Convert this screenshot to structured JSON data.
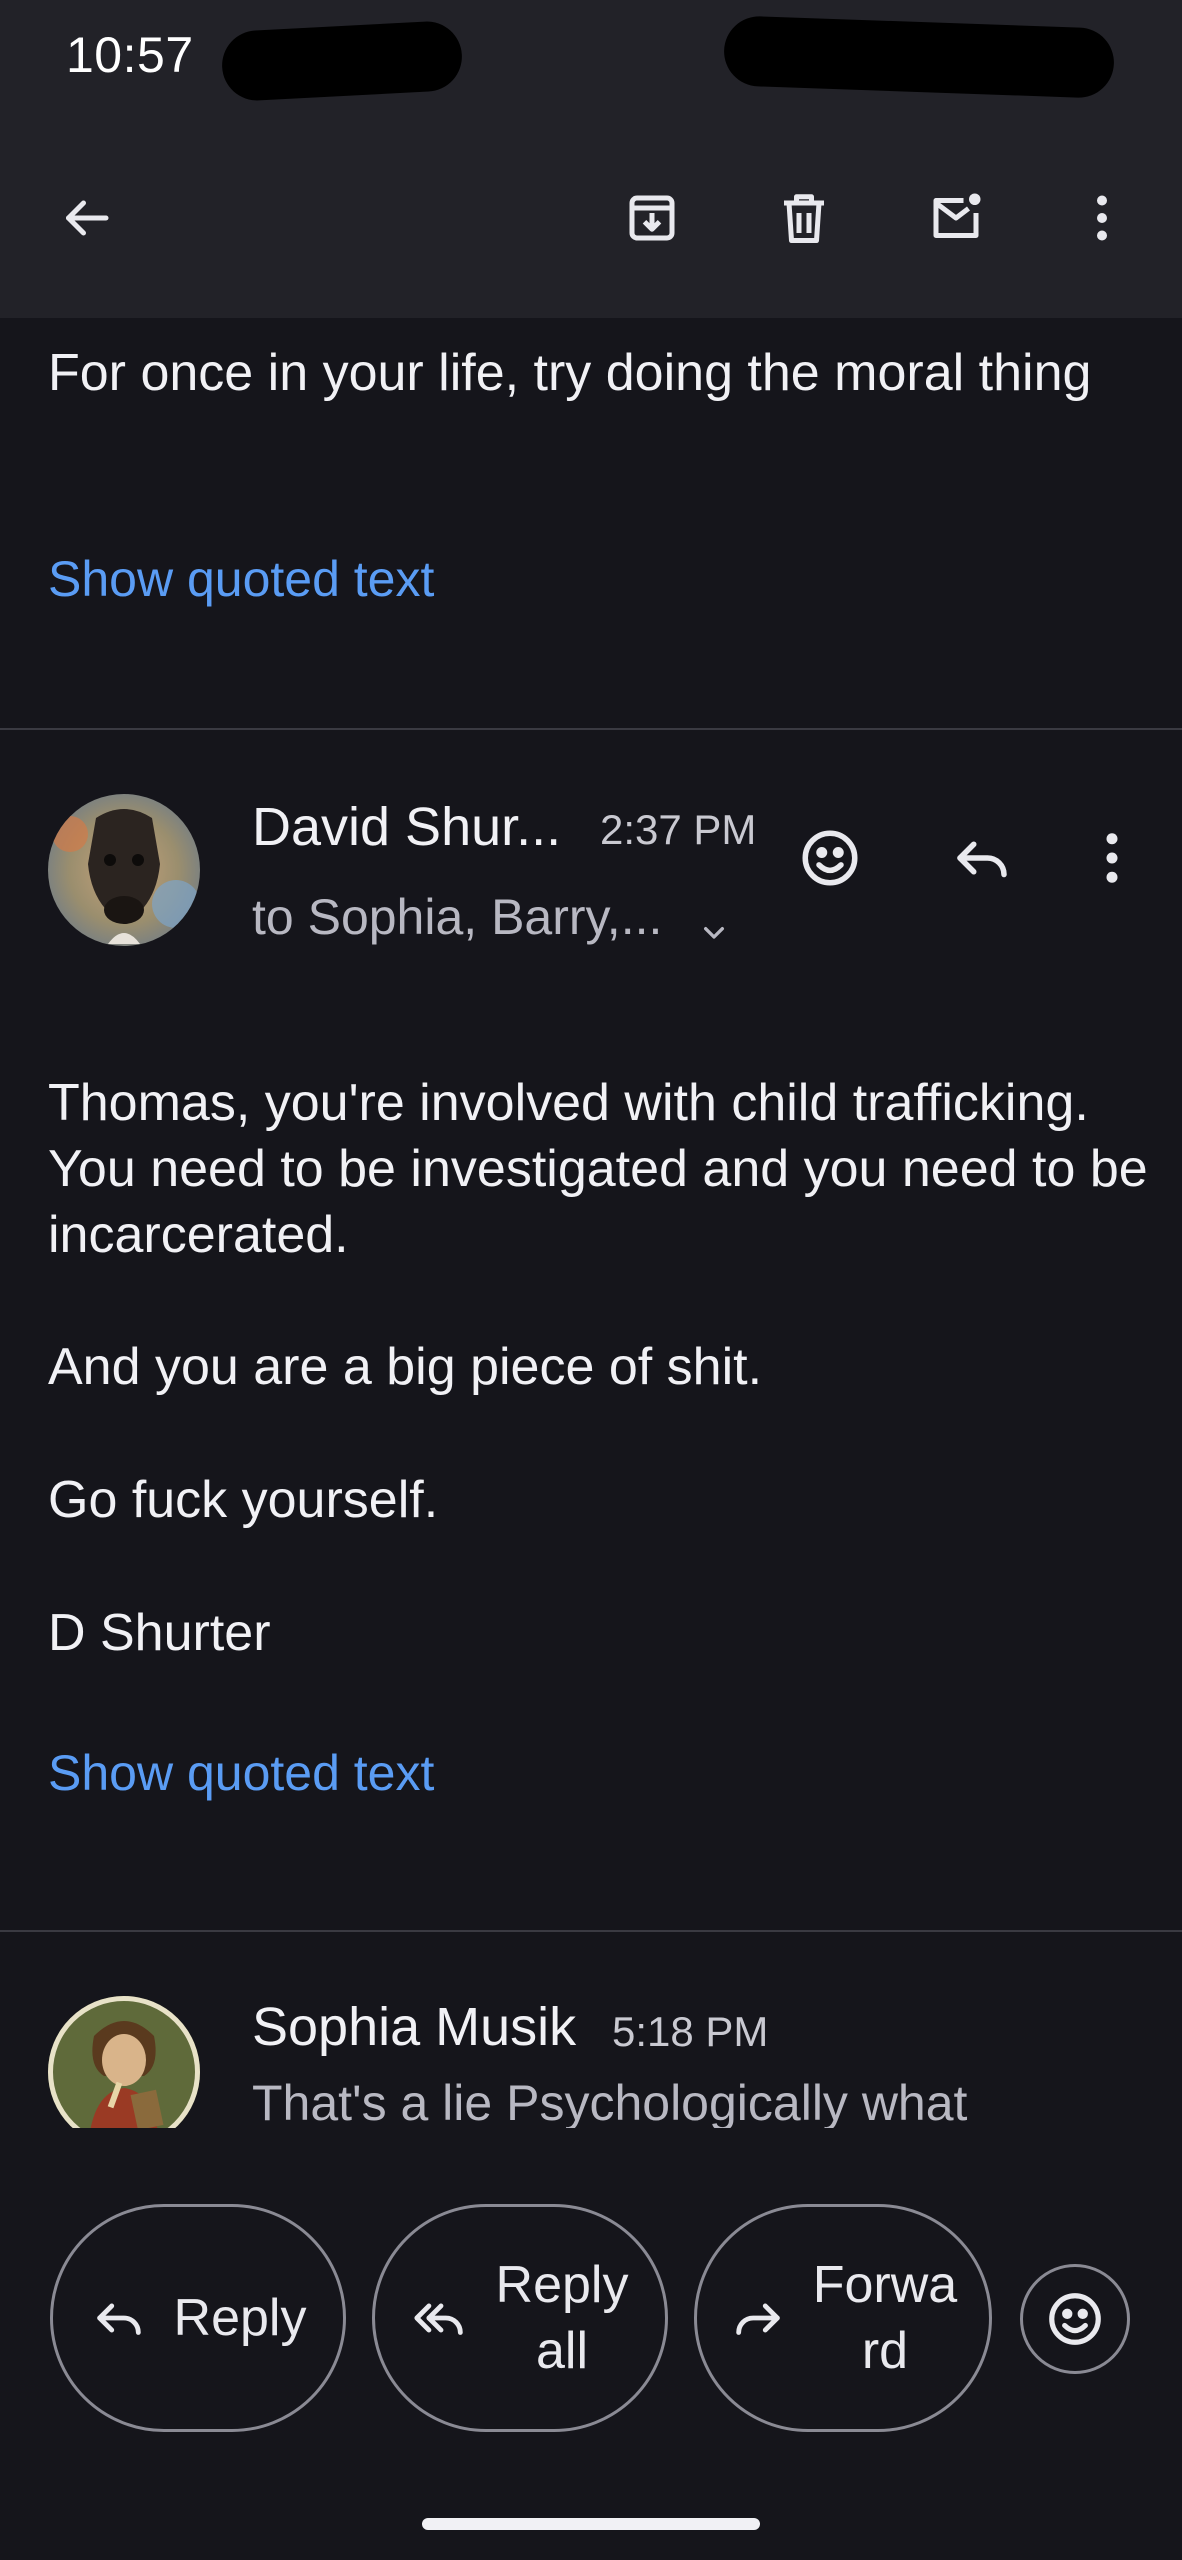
{
  "status_bar": {
    "time": "10:57"
  },
  "toolbar": {
    "icons": [
      "back-arrow-icon",
      "archive-icon",
      "delete-icon",
      "mark-unread-icon",
      "more-vert-icon"
    ]
  },
  "message_previous": {
    "text": "For once in your life, try doing the moral thing",
    "show_quoted": "Show quoted text"
  },
  "message_main": {
    "sender": "David Shur...",
    "time": "2:37 PM",
    "recipients": "to Sophia, Barry,...",
    "paragraphs": [
      "Thomas, you're involved with child trafficking. You need to be investigated and you need to be incarcerated.",
      "And you are a big piece of shit.",
      "Go fuck yourself.",
      "D Shurter"
    ],
    "show_quoted": "Show quoted text"
  },
  "message_next": {
    "sender": "Sophia Musik",
    "time": "5:18 PM",
    "snippet": "That's a lie Psychologically what"
  },
  "actions": {
    "reply": "Reply",
    "reply_all_line1": "Reply",
    "reply_all_line2": "all",
    "forward_line1": "Forwa",
    "forward_line2": "rd"
  },
  "colors": {
    "background": "#15151b",
    "toolbar": "#222228",
    "link": "#5a9cf4"
  }
}
